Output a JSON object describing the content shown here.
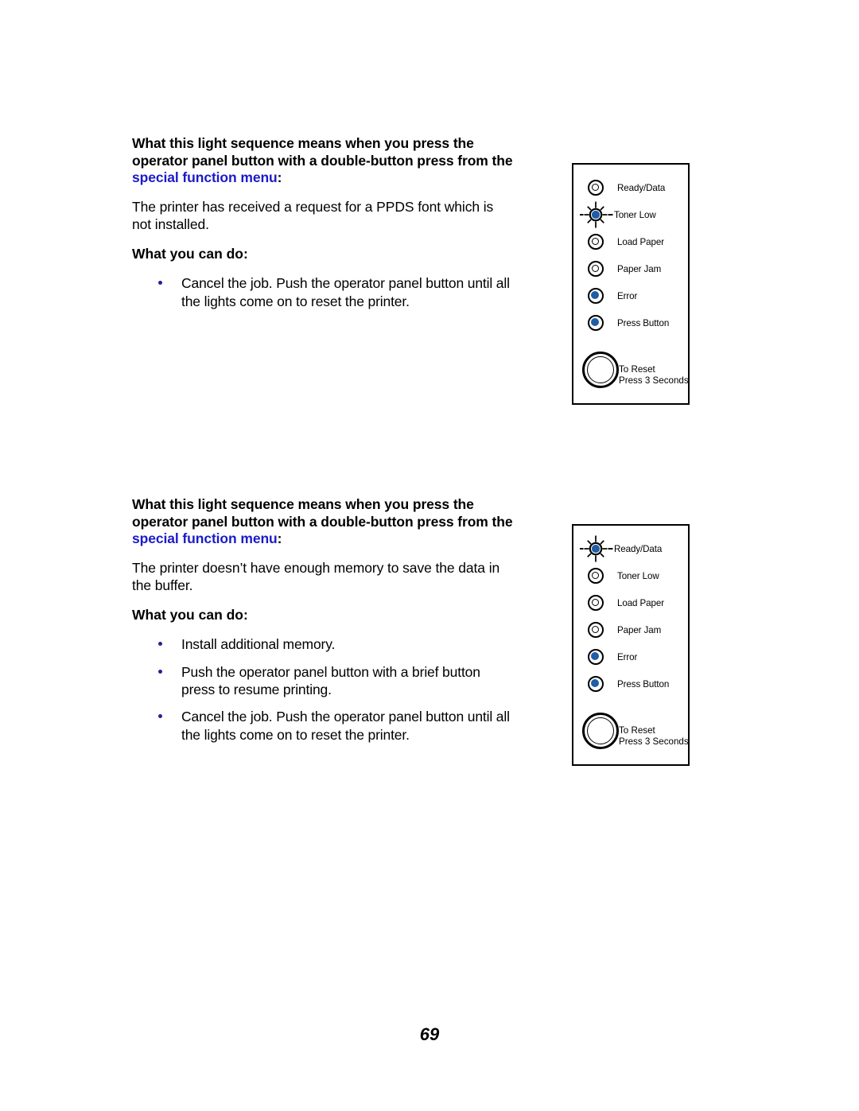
{
  "colors": {
    "accent_link": "#1b1bc8",
    "led_on": "#1f5da5",
    "bullet": "#21219b",
    "panel_border": "#000000"
  },
  "page": {
    "number": "69"
  },
  "sections": [
    {
      "heading_prefix": "What this light sequence means when you press the operator panel button with a double-button press from the ",
      "heading_accent": "special function menu",
      "heading_suffix": ":",
      "description": "The printer has received a request for a PPDS font which is not installed.",
      "subheading": "What you can do:",
      "bullets": [
        "Cancel the job. Push the operator panel button until all the lights come on to reset the printer."
      ]
    },
    {
      "heading_prefix": "What this light sequence means when you press the operator panel button with a double-button press from the ",
      "heading_accent": "special function menu",
      "heading_suffix": ":",
      "description": "The printer doesn’t have enough memory to save the data in the buffer.",
      "subheading": "What you can do:",
      "bullets": [
        "Install additional memory.",
        "Push the operator panel button with a brief button press to resume printing.",
        "Cancel the job. Push the operator panel button until all the lights come on to reset the printer."
      ]
    }
  ],
  "panels": [
    {
      "name": "operator-panel-ppds-font",
      "leds": [
        {
          "label": "Ready/Data",
          "state": "off"
        },
        {
          "label": "Toner Low",
          "state": "blink"
        },
        {
          "label": "Load Paper",
          "state": "off"
        },
        {
          "label": "Paper Jam",
          "state": "off"
        },
        {
          "label": "Error",
          "state": "on"
        },
        {
          "label": "Press Button",
          "state": "on"
        }
      ],
      "reset": {
        "line1": "To Reset",
        "line2": "Press 3 Seconds"
      }
    },
    {
      "name": "operator-panel-insufficient-memory",
      "leds": [
        {
          "label": "Ready/Data",
          "state": "blink"
        },
        {
          "label": "Toner Low",
          "state": "off"
        },
        {
          "label": "Load Paper",
          "state": "off"
        },
        {
          "label": "Paper Jam",
          "state": "off"
        },
        {
          "label": "Error",
          "state": "on"
        },
        {
          "label": "Press Button",
          "state": "on"
        }
      ],
      "reset": {
        "line1": "To Reset",
        "line2": "Press 3 Seconds"
      }
    }
  ]
}
